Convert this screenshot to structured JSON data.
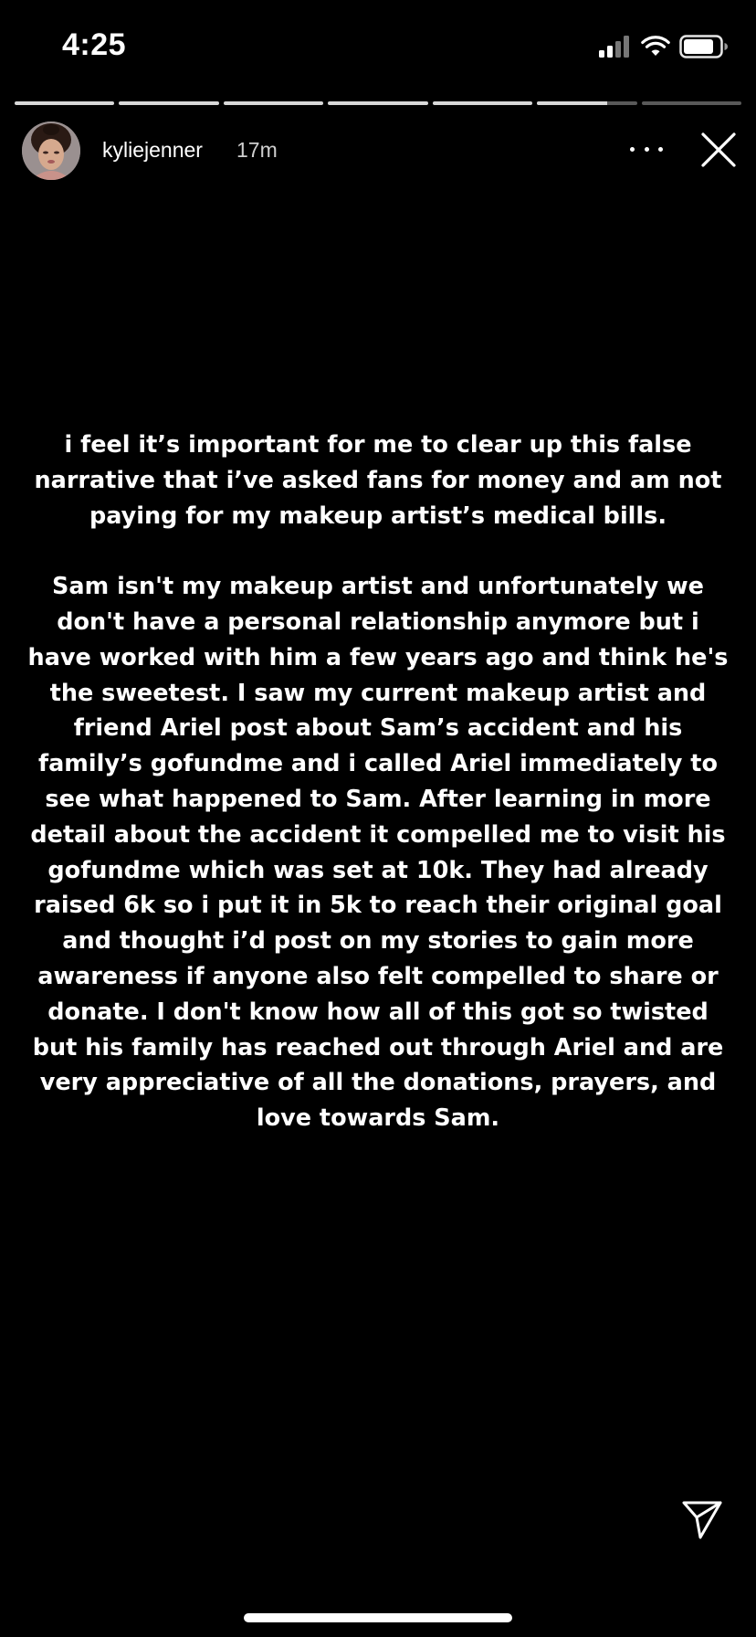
{
  "status_bar": {
    "time": "4:25",
    "signal_bars_active": 2,
    "signal_bars_total": 4,
    "battery_level": 0.75
  },
  "story_progress": {
    "segments": [
      1,
      1,
      1,
      1,
      1,
      0.7,
      0
    ],
    "active_index": 5
  },
  "header": {
    "username": "kyliejenner",
    "time_ago": "17m",
    "avatar_icon": "profile-avatar",
    "more_icon": "more-horizontal-icon",
    "close_icon": "close-icon"
  },
  "story": {
    "paragraphs": [
      "i feel it’s important for me to clear up this false narrative that i’ve asked fans for money and am not paying for my makeup artist’s medical bills.",
      "Sam isn't my makeup artist and unfortunately we don't have a personal relationship anymore but i have worked with him a few years ago and think he's the sweetest. I saw my current makeup artist and friend Ariel post about Sam’s accident and his family’s gofundme and i called Ariel immediately to see what happened to Sam. After learning in more detail about the accident it compelled me to visit his gofundme which was set at 10k. They had already raised 6k so i put it in 5k to reach their original goal and thought i’d post on my stories to gain more awareness if anyone also felt compelled to share or donate. I don't know how all of this got so twisted but his family has reached out through Ariel and are very appreciative of all the donations, prayers, and love towards Sam."
    ]
  },
  "footer": {
    "send_icon": "send-icon"
  },
  "colors": {
    "background": "#000000",
    "text": "#ffffff",
    "muted_text": "#cfcfcf"
  }
}
